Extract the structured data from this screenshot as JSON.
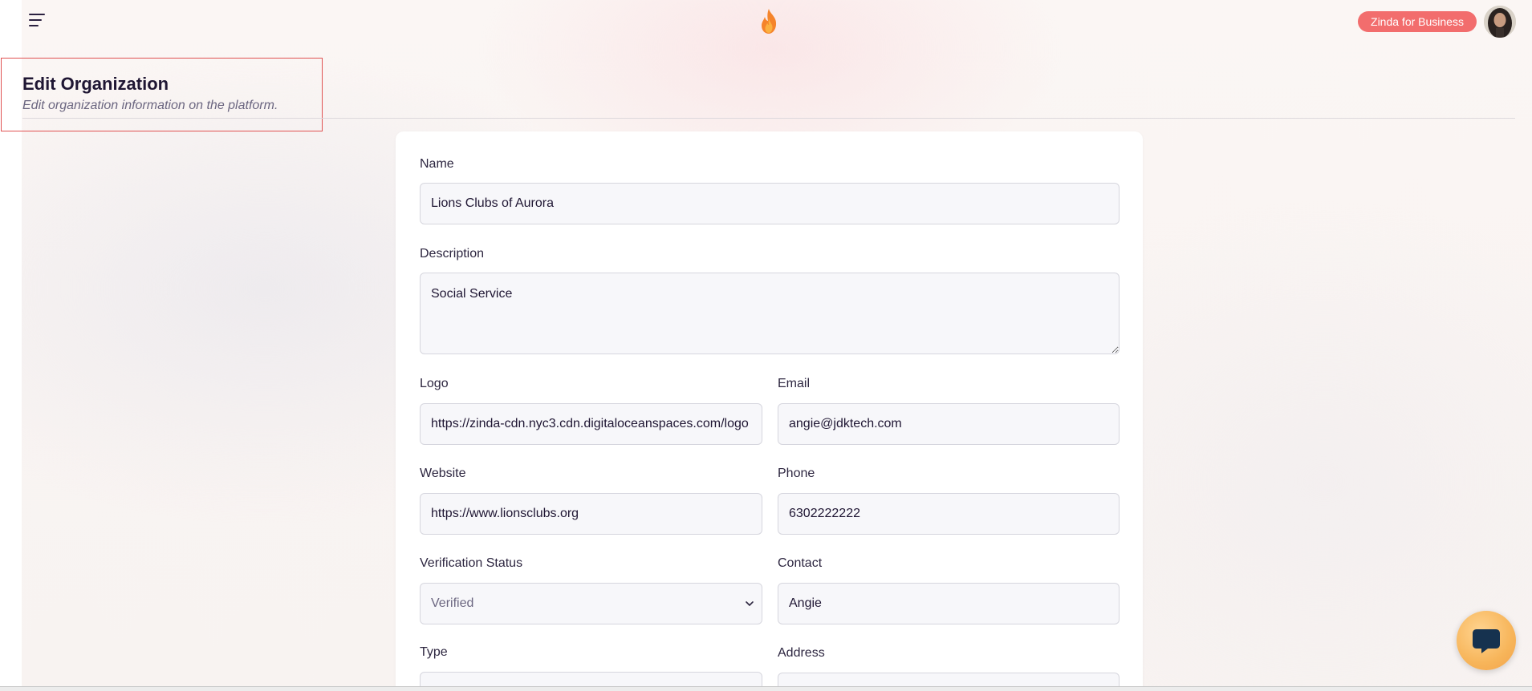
{
  "header": {
    "business_button": "Zinda for Business"
  },
  "page": {
    "title": "Edit Organization",
    "subtitle": "Edit organization information on the platform."
  },
  "form": {
    "name": {
      "label": "Name",
      "value": "Lions Clubs of Aurora"
    },
    "description": {
      "label": "Description",
      "value": "Social Service"
    },
    "logo": {
      "label": "Logo",
      "value": "https://zinda-cdn.nyc3.cdn.digitaloceanspaces.com/logo"
    },
    "email": {
      "label": "Email",
      "value": "angie@jdktech.com"
    },
    "website": {
      "label": "Website",
      "value": "https://www.lionsclubs.org"
    },
    "phone": {
      "label": "Phone",
      "value": "6302222222"
    },
    "verification_status": {
      "label": "Verification Status",
      "value": "Verified"
    },
    "contact": {
      "label": "Contact",
      "value": "Angie"
    },
    "type": {
      "label": "Type",
      "value": ""
    },
    "address": {
      "label": "Address",
      "value": ""
    }
  },
  "colors": {
    "accent": "#f26d6d",
    "flame": "#f5842b",
    "chat": "#f7b55a",
    "highlight_border": "#e05252"
  }
}
